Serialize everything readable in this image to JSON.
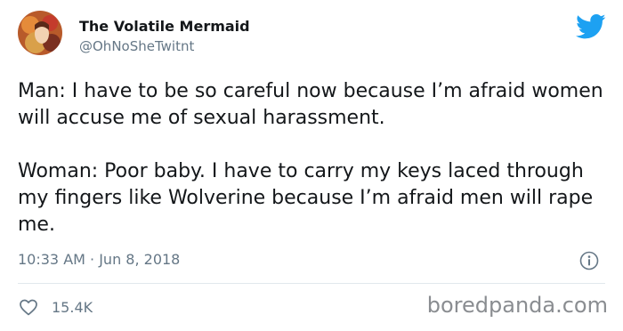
{
  "author": {
    "name": "The Volatile Mermaid",
    "handle": "@OhNoSheTwitnt"
  },
  "tweet": {
    "paragraph_1": "Man: I have to be so careful now because I’m afraid women will accuse me of sexual harassment.",
    "paragraph_2": "Woman: Poor baby. I have to carry my keys laced through my fingers like Wolverine because I’m afraid men will rape me.",
    "timestamp": "10:33 AM · Jun 8, 2018"
  },
  "engagement": {
    "likes": "15.4K"
  },
  "watermark": "boredpanda.com",
  "icons": {
    "logo": "twitter-bird-icon",
    "info": "info-icon",
    "like": "heart-icon"
  },
  "colors": {
    "twitter_blue": "#1da1f2",
    "text": "#14171a",
    "secondary": "#657786",
    "divider": "#e1e8ed"
  }
}
